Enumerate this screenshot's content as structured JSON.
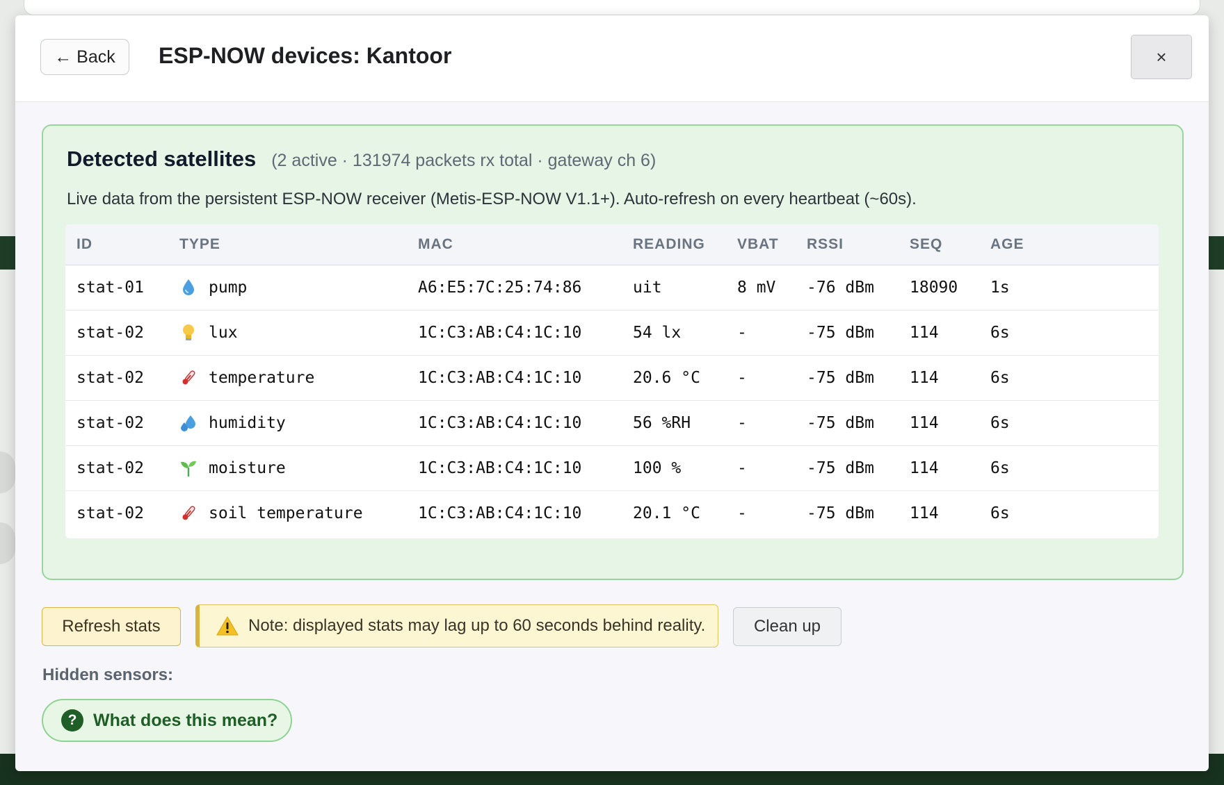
{
  "header": {
    "back_label": "← Back",
    "title": "ESP-NOW devices: Kantoor",
    "close_label": "×"
  },
  "satellites": {
    "title": "Detected satellites",
    "summary": "(2 active · 131974 packets rx total · gateway ch 6)",
    "description": "Live data from the persistent ESP-NOW receiver (Metis-ESP-NOW V1.1+). Auto-refresh on every heartbeat (~60s).",
    "columns": [
      "ID",
      "TYPE",
      "MAC",
      "READING",
      "VBAT",
      "RSSI",
      "SEQ",
      "AGE"
    ],
    "rows": [
      {
        "id": "stat-01",
        "icon": "droplet-icon",
        "type": "pump",
        "mac": "A6:E5:7C:25:74:86",
        "reading": "uit",
        "vbat": "8 mV",
        "rssi": "-76 dBm",
        "seq": "18090",
        "age": "1s"
      },
      {
        "id": "stat-02",
        "icon": "lightbulb-icon",
        "type": "lux",
        "mac": "1C:C3:AB:C4:1C:10",
        "reading": "54 lx",
        "vbat": "-",
        "rssi": "-75 dBm",
        "seq": "114",
        "age": "6s"
      },
      {
        "id": "stat-02",
        "icon": "thermometer-icon",
        "type": "temperature",
        "mac": "1C:C3:AB:C4:1C:10",
        "reading": "20.6 °C",
        "vbat": "-",
        "rssi": "-75 dBm",
        "seq": "114",
        "age": "6s"
      },
      {
        "id": "stat-02",
        "icon": "water-drops-icon",
        "type": "humidity",
        "mac": "1C:C3:AB:C4:1C:10",
        "reading": "56 %RH",
        "vbat": "-",
        "rssi": "-75 dBm",
        "seq": "114",
        "age": "6s"
      },
      {
        "id": "stat-02",
        "icon": "seedling-icon",
        "type": "moisture",
        "mac": "1C:C3:AB:C4:1C:10",
        "reading": "100 %",
        "vbat": "-",
        "rssi": "-75 dBm",
        "seq": "114",
        "age": "6s"
      },
      {
        "id": "stat-02",
        "icon": "thermometer-icon",
        "type": "soil temperature",
        "mac": "1C:C3:AB:C4:1C:10",
        "reading": "20.1 °C",
        "vbat": "-",
        "rssi": "-75 dBm",
        "seq": "114",
        "age": "6s"
      }
    ]
  },
  "actions": {
    "refresh_label": "Refresh stats",
    "note_text": "Note: displayed stats may lag up to 60 seconds behind reality.",
    "cleanup_label": "Clean up",
    "hidden_sensors_label": "Hidden sensors:",
    "help_label": "What does this mean?",
    "help_icon": "question-circle-icon"
  },
  "colors": {
    "panel_bg": "#e7f5e7",
    "panel_border": "#98d59e",
    "warning_bg": "#fdf6d3",
    "help_green": "#1f5e26"
  }
}
